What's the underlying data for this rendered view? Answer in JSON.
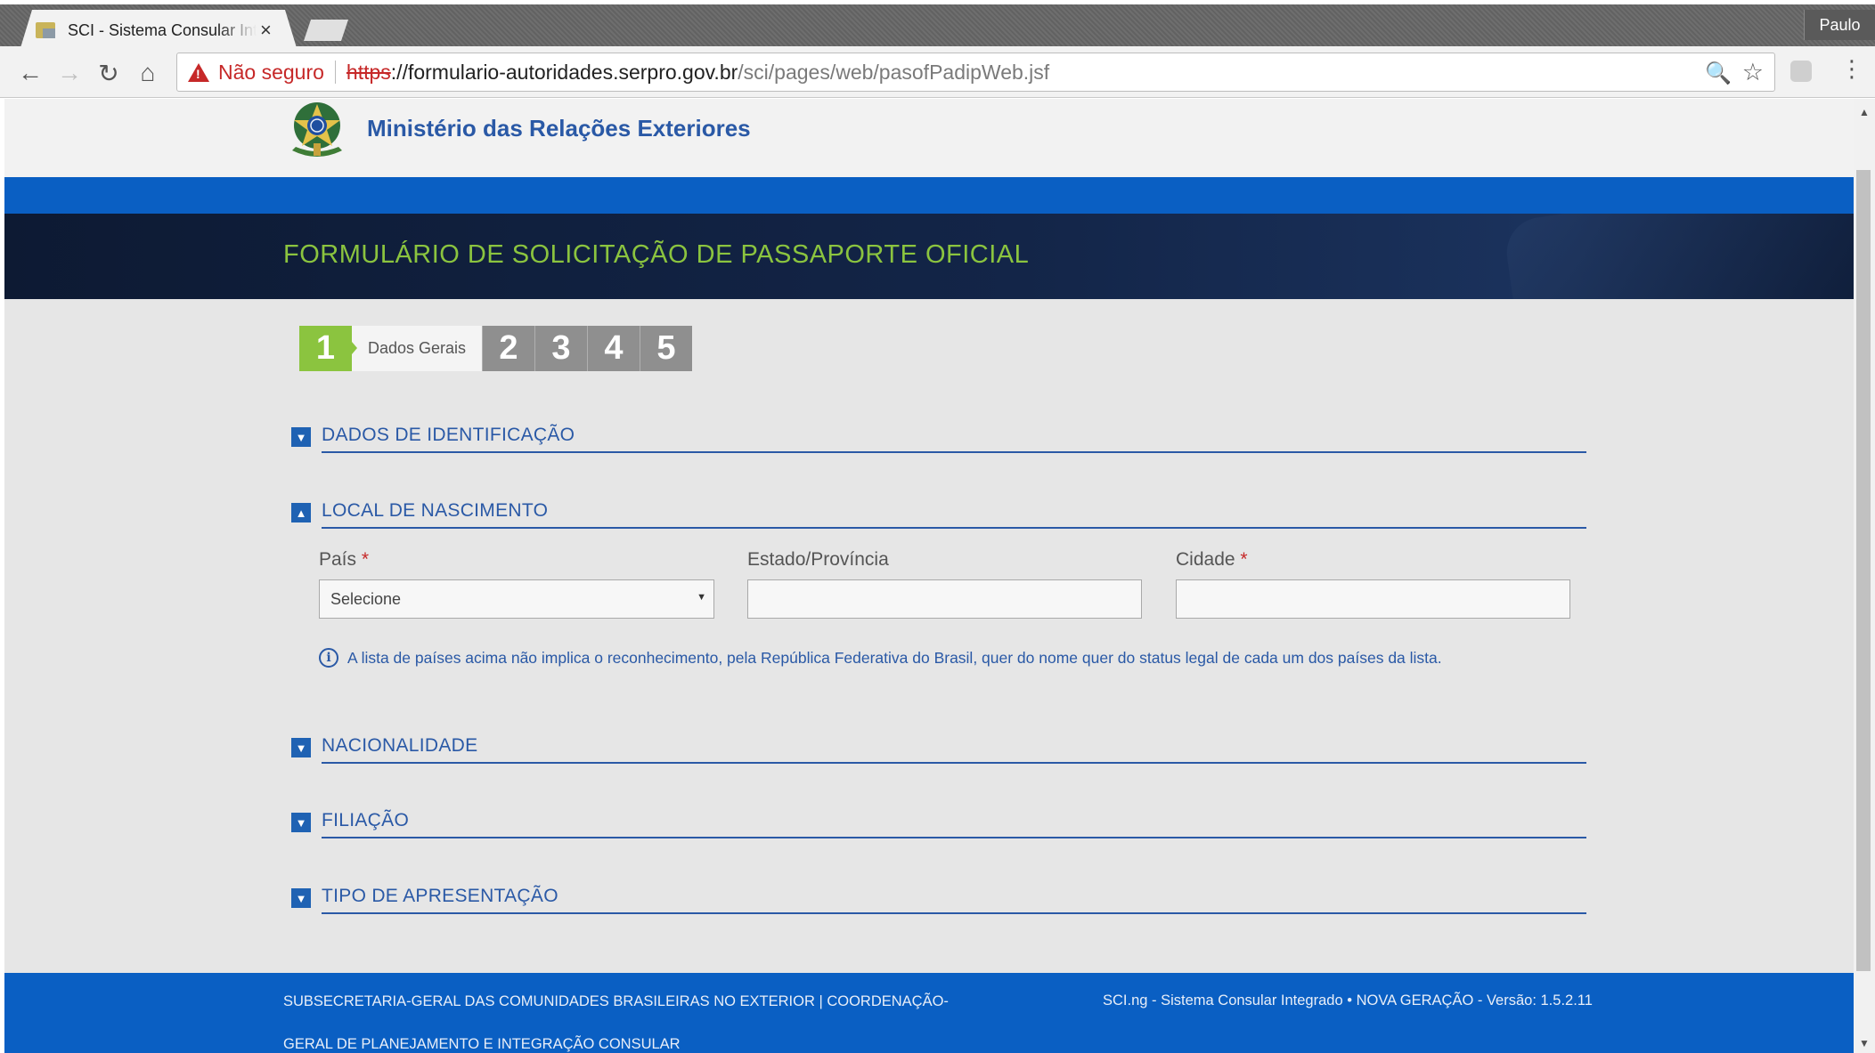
{
  "browser": {
    "tab_title": "SCI - Sistema Consular Integrado",
    "tab_close": "×",
    "profile_name": "Paulo",
    "security_label": "Não seguro",
    "url_scheme": "https",
    "url_host": "://formulario-autoridades.serpro.gov.br",
    "url_path": "/sci/pages/web/pasofPadipWeb.jsf",
    "icons": {
      "back": "←",
      "forward": "→",
      "reload": "↻",
      "home": "⌂",
      "zoom": "🔍",
      "star": "☆",
      "menu": "⋮"
    }
  },
  "header": {
    "ministry_name": "Ministério das Relações Exteriores",
    "form_title": "FORMULÁRIO DE SOLICITAÇÃO DE PASSAPORTE OFICIAL"
  },
  "steps": {
    "current": {
      "number": "1",
      "label": "Dados Gerais"
    },
    "others": [
      "2",
      "3",
      "4",
      "5"
    ]
  },
  "sections": [
    {
      "label": "DADOS DE IDENTIFICAÇÃO",
      "expanded": false
    },
    {
      "label": "LOCAL DE NASCIMENTO",
      "expanded": true
    },
    {
      "label": "NACIONALIDADE",
      "expanded": false
    },
    {
      "label": "FILIAÇÃO",
      "expanded": false
    },
    {
      "label": "TIPO DE APRESENTAÇÃO",
      "expanded": false
    }
  ],
  "birthplace": {
    "pais_label": "País",
    "pais_value": "Selecione",
    "estado_label": "Estado/Província",
    "estado_value": "",
    "cidade_label": "Cidade",
    "cidade_value": "",
    "required_mark": "*",
    "info_text": "A lista de países acima não implica o reconhecimento, pela República Federativa do Brasil, quer do nome quer do status legal de cada um dos países da lista."
  },
  "footer": {
    "left_text": "SUBSECRETARIA-GERAL DAS COMUNIDADES BRASILEIRAS NO EXTERIOR | COORDENAÇÃO-GERAL DE PLANEJAMENTO E INTEGRAÇÃO CONSULAR",
    "right_text": "SCI.ng - Sistema Consular Integrado • NOVA GERAÇÃO - Versão: 1.5.2.11"
  },
  "colors": {
    "accent_blue": "#0a5fc3",
    "text_blue": "#2a59a6",
    "step_green": "#8bc43f",
    "title_band": "#132548"
  }
}
